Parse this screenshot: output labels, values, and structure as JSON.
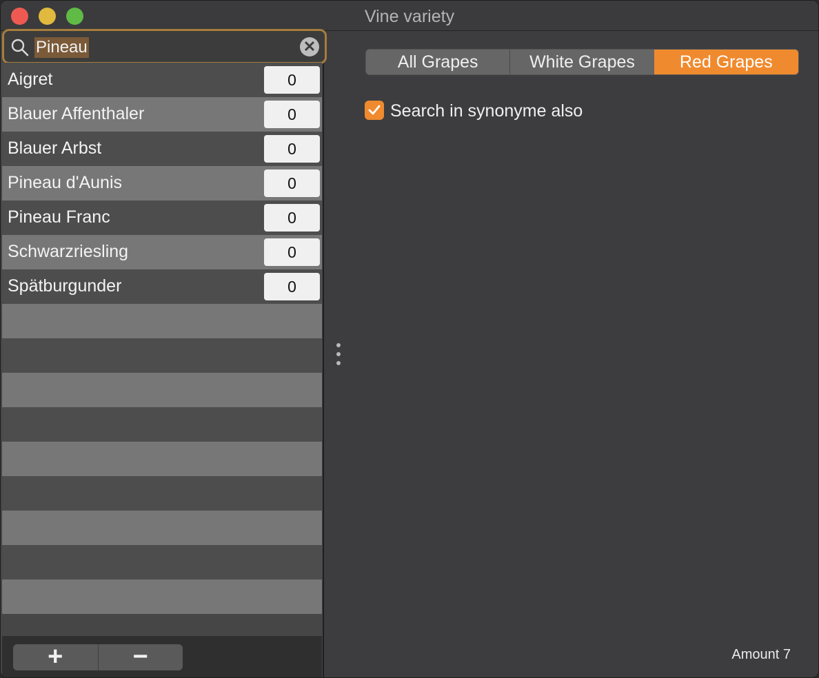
{
  "window": {
    "title": "Vine variety"
  },
  "search": {
    "value": "Pineau",
    "clear_icon": "clear-icon"
  },
  "grapes": [
    {
      "name": "Aigret",
      "count": "0"
    },
    {
      "name": "Blauer Affenthaler",
      "count": "0"
    },
    {
      "name": "Blauer Arbst",
      "count": "0"
    },
    {
      "name": "Pineau d'Aunis",
      "count": "0"
    },
    {
      "name": "Pineau Franc",
      "count": "0"
    },
    {
      "name": "Schwarzriesling",
      "count": "0"
    },
    {
      "name": "Spätburgunder",
      "count": "0"
    }
  ],
  "list_actions": {
    "add_label": "+",
    "remove_label": "−"
  },
  "filter": {
    "tabs": [
      {
        "label": "All Grapes",
        "selected": false
      },
      {
        "label": "White Grapes",
        "selected": false
      },
      {
        "label": "Red Grapes",
        "selected": true
      }
    ]
  },
  "options": {
    "synonym_label": "Search in synonyme also",
    "synonym_checked": true
  },
  "status": {
    "amount_text": "Amount 7"
  },
  "colors": {
    "accent": "#f08a2e",
    "focus_ring": "#a77d3c"
  }
}
